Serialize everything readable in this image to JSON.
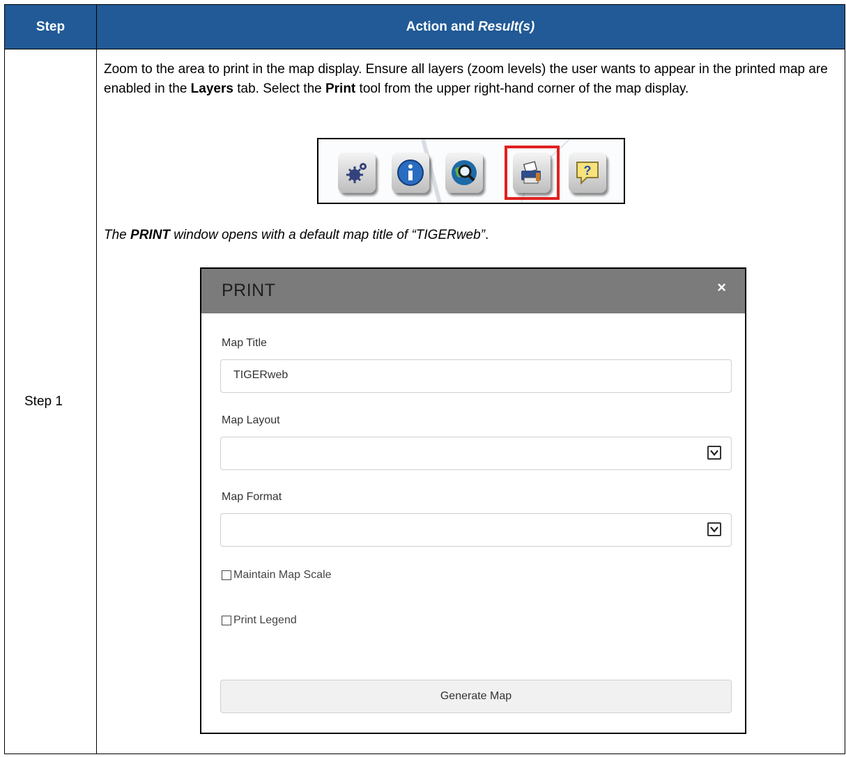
{
  "table": {
    "header": {
      "step": "Step",
      "action": "Action and",
      "result": "Result(s)"
    },
    "row": {
      "step": "Step 1",
      "instruction": {
        "part1": "Zoom to the area to print in the map display. Ensure all layers (zoom levels) the user wants to appear in the printed map are enabled in the ",
        "layers": "Layers",
        "part2": " tab. Select the ",
        "print": "Print",
        "part3": " tool from the upper right-hand corner of the map display."
      },
      "result": {
        "part1": "The ",
        "print": "PRINT",
        "part2": " window opens with a default map title of “TIGERweb”",
        "period": "."
      }
    }
  },
  "toolbar": {
    "icons": [
      "tools-gear-icon",
      "info-icon",
      "search-globe-icon",
      "printer-icon",
      "help-icon"
    ],
    "highlight_color": "#e02020"
  },
  "print_dialog": {
    "title": "PRINT",
    "close": "×",
    "map_title_label": "Map Title",
    "map_title_value": "TIGERweb",
    "map_layout_label": "Map Layout",
    "map_layout_value": "",
    "map_format_label": "Map Format",
    "map_format_value": "",
    "maintain_scale_label": "Maintain Map Scale",
    "print_legend_label": "Print Legend",
    "generate_button": "Generate Map"
  },
  "colors": {
    "header_bg": "#215a96",
    "dialog_header_bg": "#7b7b7b"
  }
}
